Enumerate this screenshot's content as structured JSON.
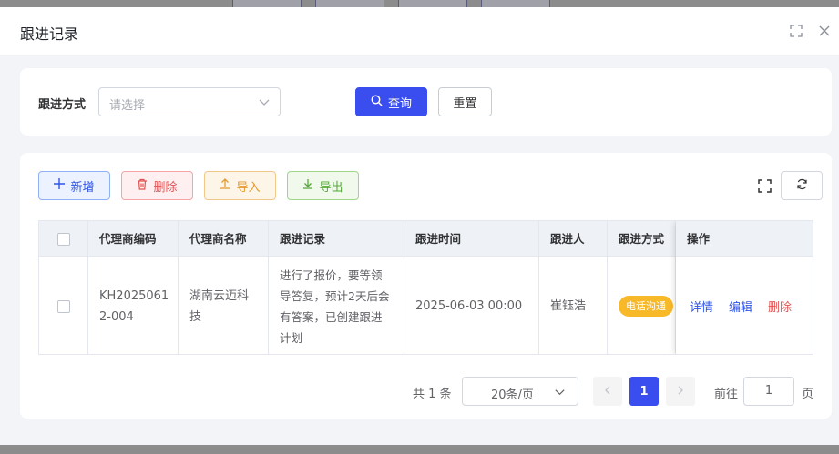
{
  "dialog": {
    "title": "跟进记录"
  },
  "search": {
    "label": "跟进方式",
    "placeholder": "请选择",
    "query_label": "查询",
    "reset_label": "重置"
  },
  "toolbar": {
    "add_label": "新增",
    "delete_label": "删除",
    "import_label": "导入",
    "export_label": "导出"
  },
  "table": {
    "columns": [
      "代理商编码",
      "代理商名称",
      "跟进记录",
      "跟进时间",
      "跟进人",
      "跟进方式",
      "操作"
    ],
    "rows": [
      {
        "code_line1": "KH2025061",
        "code_line2": "2-004",
        "name_line1": "湖南云迈科",
        "name_line2": "技",
        "record_lines": [
          "进行了报价，要等领",
          "导答复，预计2天后会",
          "有答案，已创建跟进",
          "计划"
        ],
        "time": "2025-06-03 00:00",
        "person": "崔钰浩",
        "method": "电话沟通",
        "actions": {
          "detail": "详情",
          "edit": "编辑",
          "delete": "删除"
        }
      }
    ]
  },
  "pagination": {
    "total": "共 1 条",
    "page_size": "20条/页",
    "current_page": "1",
    "goto_label": "前往",
    "goto_value": "1",
    "goto_suffix": "页"
  },
  "colors": {
    "primary": "#3a4ef0",
    "danger": "#e05252",
    "warning": "#e39a2f",
    "success": "#56a83b",
    "badge": "#f7b928"
  }
}
